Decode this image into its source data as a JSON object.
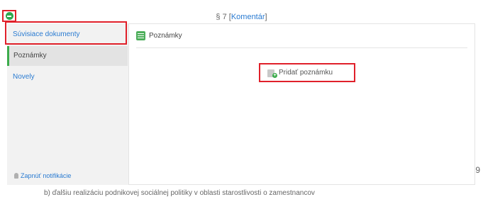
{
  "header": {
    "section_label": "§ 7",
    "comment_link": "Komentár",
    "bracket_open": "[",
    "bracket_close": "]"
  },
  "sidebar": {
    "items": [
      {
        "label": "Súvisiace dokumenty",
        "active": false
      },
      {
        "label": "Poznámky",
        "active": true
      },
      {
        "label": "Novely",
        "active": false
      }
    ],
    "notification_label": "Zapnúť notifikácie"
  },
  "content": {
    "header_label": "Poznámky",
    "add_note_label": "Pridať poznámku"
  },
  "page": {
    "stray_char": "9",
    "bottom_text": "b) ďalšiu realizáciu podnikovej sociálnej politiky v oblasti starostlivosti o zamestnancov"
  },
  "colors": {
    "accent_green": "#3cab4c",
    "link_blue": "#2a7bd1",
    "highlight_red": "#e0202a"
  },
  "icons": [
    "collapse-icon",
    "notes-icon",
    "add-note-icon",
    "bell-icon"
  ]
}
